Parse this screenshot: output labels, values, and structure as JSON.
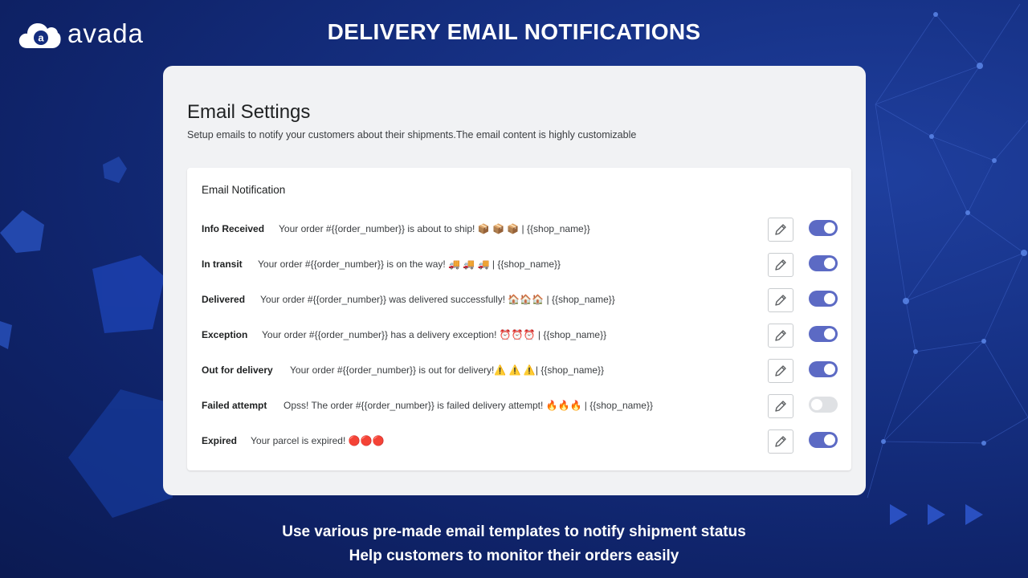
{
  "brand": {
    "name": "avada",
    "logo_letter": "a"
  },
  "page_title": "DELIVERY EMAIL NOTIFICATIONS",
  "settings": {
    "title": "Email Settings",
    "subtitle": "Setup emails to notify your customers about their shipments.The email content is highly customizable",
    "panel_title": "Email Notification",
    "rows": [
      {
        "label": "Info Received",
        "message": "Your order #{{order_number}} is about to ship! 📦 📦 📦 | {{shop_name}}",
        "enabled": true
      },
      {
        "label": "In transit",
        "message": "Your order #{{order_number}} is on the way! 🚚 🚚 🚚 | {{shop_name}}",
        "enabled": true
      },
      {
        "label": "Delivered",
        "message": "Your order #{{order_number}} was delivered successfully! 🏠🏠🏠 | {{shop_name}}",
        "enabled": true
      },
      {
        "label": "Exception",
        "message": "Your order #{{order_number}} has a delivery exception! ⏰⏰⏰ | {{shop_name}}",
        "enabled": true
      },
      {
        "label": "Out for delivery",
        "message": "Your order #{{order_number}} is out for delivery!⚠️ ⚠️ ⚠️| {{shop_name}}",
        "enabled": true
      },
      {
        "label": "Failed attempt",
        "message": "Opss! The order #{{order_number}} is failed delivery attempt! 🔥🔥🔥 | {{shop_name}}",
        "enabled": false
      },
      {
        "label": "Expired",
        "message": "Your parcel is expired! 🔴🔴🔴",
        "enabled": true
      }
    ],
    "edit_icon": "pencil-icon"
  },
  "footer": {
    "line1": "Use various pre-made email templates to notify shipment status",
    "line2": "Help customers to monitor their orders easily"
  },
  "colors": {
    "background": "#132c7e",
    "toggle_on": "#5c6ac4",
    "toggle_off": "#dfe1e4",
    "card": "#f1f2f4"
  }
}
